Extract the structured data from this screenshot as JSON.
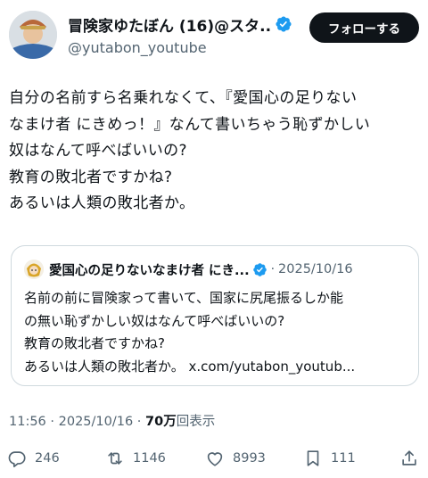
{
  "author": {
    "display_name": "冒険家ゆたぼん (16)@スタ...",
    "handle": "@yutabon_youtube",
    "follow_label": "フォローする"
  },
  "tweet": {
    "lines": [
      "自分の名前すら名乗れなくて、『愛国心の足りない",
      "なまけ者 にきめっ！』なんて書いちゃう恥ずかしい",
      "奴はなんて呼べばいいの?",
      "教育の敗北者ですかね?",
      "あるいは人類の敗北者か。"
    ]
  },
  "quote": {
    "display_name": "愛国心の足りないなまけ者 にき...",
    "dot": "·",
    "date": "2025/10/16",
    "lines": [
      "名前の前に冒険家って書いて、国家に尻尾振るしか能",
      "の無い恥ずかしい奴はなんて呼べばいいの?",
      "教育の敗北者ですかね?",
      "あるいは人類の敗北者か。 x.com/yutabon_youtub..."
    ]
  },
  "meta": {
    "time": "11:56",
    "sep1": " · ",
    "date": "2025/10/16",
    "sep2": " · ",
    "views_count": "70万",
    "views_label": "回表示"
  },
  "actions": {
    "replies": "246",
    "reposts": "1146",
    "likes": "8993",
    "bookmarks": "111"
  },
  "colors": {
    "verified_blue": "#1d9bf0",
    "secondary_text": "#536471",
    "follow_button_bg": "#0f1419"
  }
}
